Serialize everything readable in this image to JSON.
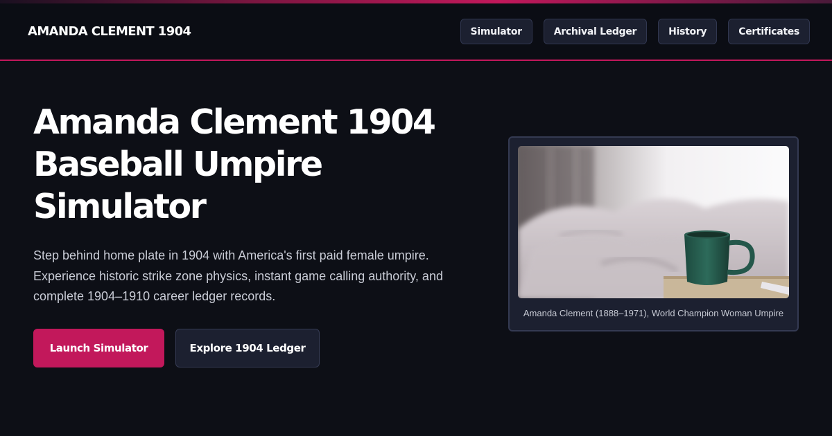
{
  "brand": "AMANDA CLEMENT 1904",
  "nav": [
    "Simulator",
    "Archival Ledger",
    "History",
    "Certificates"
  ],
  "hero": {
    "title_lines": [
      "Amanda Clement 1904",
      "Baseball Umpire",
      "Simulator"
    ],
    "lead": "Step behind home plate in 1904 with America's first paid female umpire. Experience historic strike zone physics, instant game calling authority, and complete 1904–1910 career ledger records.",
    "primary_cta": "Launch Simulator",
    "secondary_cta": "Explore 1904 Ledger"
  },
  "figure": {
    "caption": "Amanda Clement (1888–1971), World Champion Woman Umpire"
  },
  "colors": {
    "accent": "#c2185b",
    "background": "#0d0f16",
    "surface": "#1c2030"
  }
}
